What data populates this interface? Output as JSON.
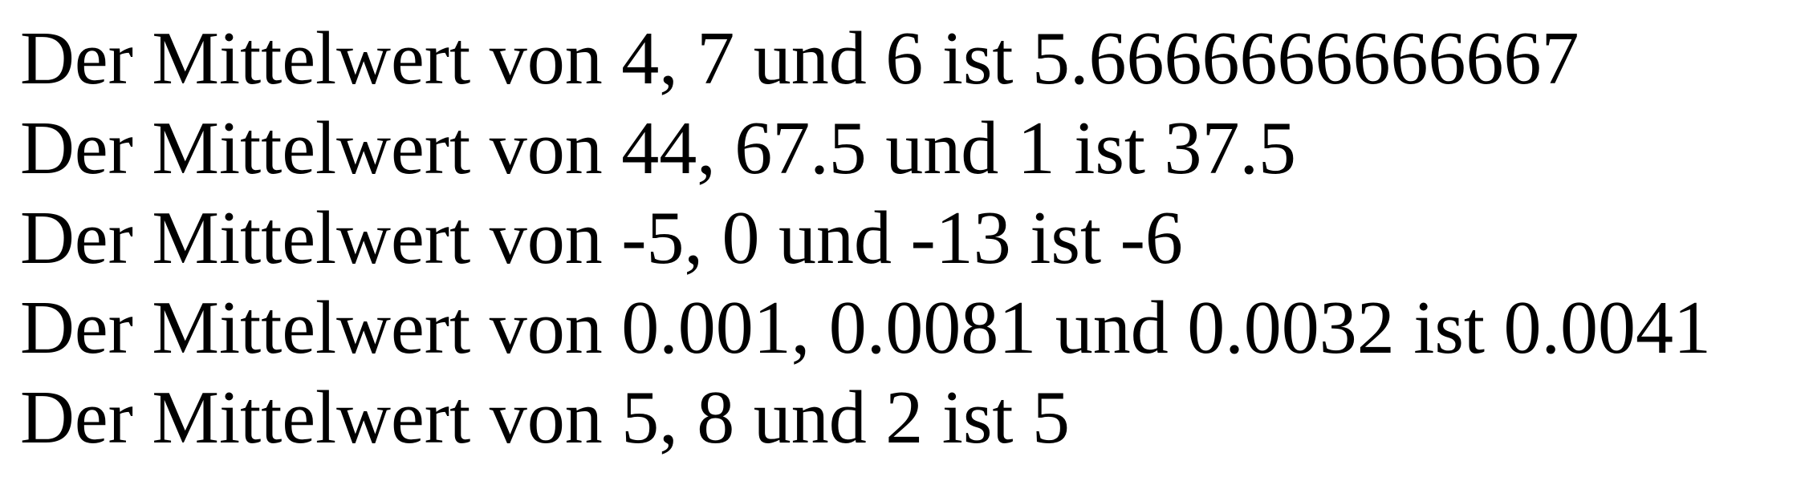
{
  "lines": [
    "Der Mittelwert von 4, 7 und 6 ist 5.6666666666667",
    "Der Mittelwert von 44, 67.5 und 1 ist 37.5",
    "Der Mittelwert von -5, 0 und -13 ist -6",
    "Der Mittelwert von 0.001, 0.0081 und 0.0032 ist 0.0041",
    "Der Mittelwert von 5, 8 und 2 ist 5"
  ]
}
